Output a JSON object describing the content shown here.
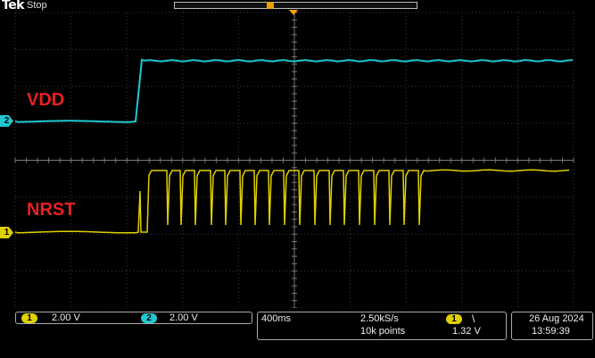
{
  "header": {
    "brand": "Tek",
    "run_state": "Stop"
  },
  "waveform_labels": {
    "ch2": "VDD",
    "ch1": "NRST"
  },
  "channels": [
    {
      "id": "1",
      "scale": "2.00 V",
      "color": "#e0d000"
    },
    {
      "id": "2",
      "scale": "2.00 V",
      "color": "#1fc8d0"
    }
  ],
  "horizontal": {
    "time_div": "400ms",
    "sample_rate": "2.50kS/s",
    "record_length": "10k points"
  },
  "trigger": {
    "source": "1",
    "slope": "\\",
    "level": "1.32 V"
  },
  "datetime": {
    "date": "26 Aug 2024",
    "time": "13:59:39"
  },
  "colors": {
    "ch1": "#e0d000",
    "ch2": "#1fc8d0",
    "label": "#e82020",
    "trigger_marker": "#f5a000"
  }
}
